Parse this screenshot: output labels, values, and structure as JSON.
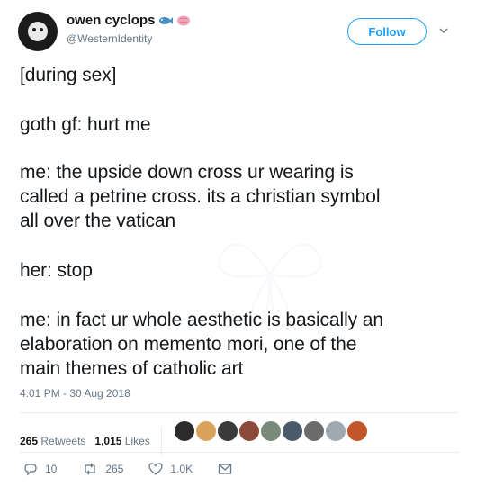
{
  "tweet": {
    "display_name": "owen cyclops",
    "handle": "@WesternIdentity",
    "follow_label": "Follow",
    "lines": [
      "[during sex]",
      "goth gf: hurt me",
      "me: the upside down cross ur wearing is",
      "called a petrine cross. its a christian symbol",
      "all over the vatican",
      "her: stop",
      "me: in fact ur whole aesthetic is basically an",
      "elaboration on memento mori, one of the",
      "main themes of catholic art"
    ],
    "timestamp": "4:01 PM - 30 Aug 2018"
  },
  "stats": {
    "retweets_count": "265",
    "retweets_label": "Retweets",
    "likes_count": "1,015",
    "likes_label": "Likes"
  },
  "actions": {
    "reply_count": "10",
    "retweet_count": "265",
    "like_count": "1.0K"
  },
  "icons": {
    "name_emoji_1": "fish-emoji",
    "name_emoji_2": "brain-emoji"
  },
  "colors": {
    "accent": "#1da1f2",
    "text": "#14171a",
    "muted": "#657786",
    "retweet_icon": "#657786"
  }
}
